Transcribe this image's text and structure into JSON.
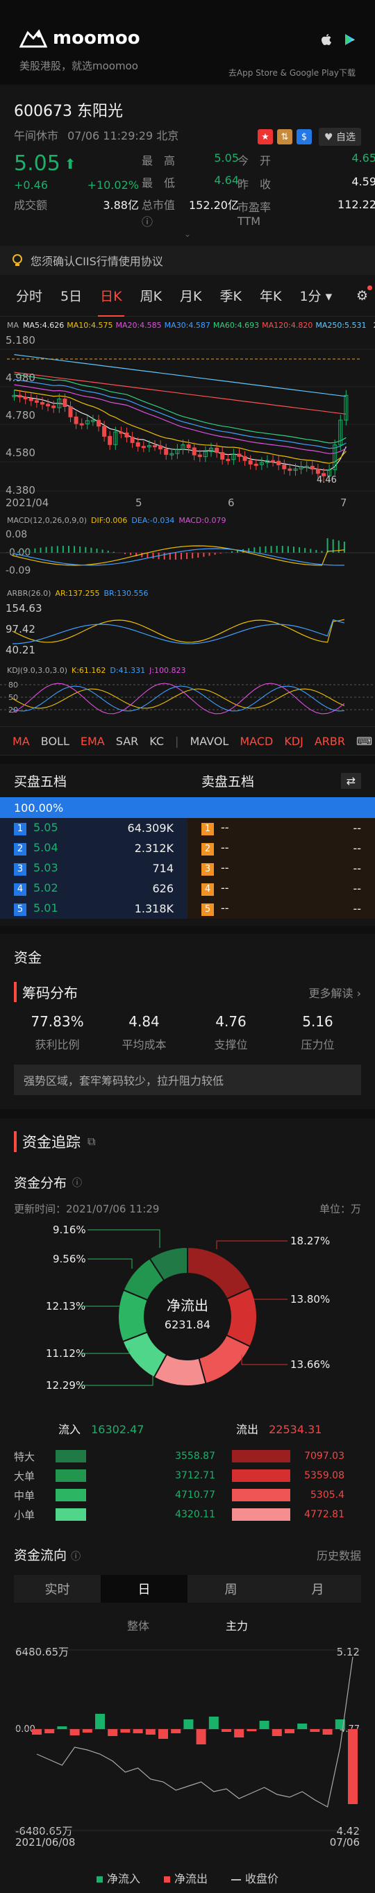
{
  "banner": {
    "brand": "moomoo",
    "tagline": "美股港股，就选moomoo",
    "store_text": "去App Store & Google Play下载"
  },
  "stock": {
    "code": "600673",
    "name": "东阳光",
    "status": "午间休市",
    "time": "07/06 11:29:29 北京",
    "watch_label": "自选",
    "price": "5.05",
    "change": "+0.46",
    "change_pct": "+10.02%",
    "volume_label": "成交额",
    "volume": "3.88亿",
    "high_label": "最　高",
    "high": "5.05",
    "low_label": "最　低",
    "low": "4.64",
    "cap_label": "总市值",
    "cap": "152.20亿",
    "open_label": "今　开",
    "open": "4.65",
    "prev_label": "昨　收",
    "prev": "4.59",
    "pe_label": "市盈率TTM",
    "pe": "112.22"
  },
  "notice": "您须确认CIIS行情使用协议",
  "tabs": [
    "分时",
    "5日",
    "日K",
    "周K",
    "月K",
    "季K",
    "年K",
    "1分"
  ],
  "active_tab": 2,
  "ma": {
    "title": "MA",
    "items": [
      {
        "label": "MA5:4.626",
        "color": "#e8e8e8"
      },
      {
        "label": "MA10:4.575",
        "color": "#f0c000"
      },
      {
        "label": "MA20:4.585",
        "color": "#e050e0"
      },
      {
        "label": "MA30:4.587",
        "color": "#40a0ff"
      },
      {
        "label": "MA60:4.693",
        "color": "#30d080"
      },
      {
        "label": "MA120:4.820",
        "color": "#ff5050"
      },
      {
        "label": "MA250:5.531",
        "color": "#60c8ff"
      }
    ],
    "right": "2"
  },
  "kline": {
    "y_top": "5.180",
    "y1": "4.980",
    "y2": "4.780",
    "y3": "4.580",
    "y_bottom": "4.380",
    "x_labels": [
      "2021/04",
      "5",
      "6",
      "7"
    ],
    "low_mark": "4.46"
  },
  "macd": {
    "label": "MACD(12,0,26,0,9,0)",
    "dif": "DIF:0.006",
    "dea": "DEA:-0.034",
    "macd": "MACD:0.079",
    "y": [
      "0.08",
      "-0.00",
      "-0.09"
    ]
  },
  "arbr": {
    "label": "ARBR(26.0)",
    "ar": "AR:137.255",
    "br": "BR:130.556",
    "y": [
      "154.63",
      "97.42",
      "40.21"
    ]
  },
  "kdj": {
    "label": "KDJ(9.0,3.0,3.0)",
    "k": "K:61.162",
    "d": "D:41.331",
    "j": "J:100.823",
    "y": [
      "80",
      "50",
      "20"
    ]
  },
  "indicator_tabs": [
    "MA",
    "BOLL",
    "EMA",
    "SAR",
    "KC",
    "MAVOL",
    "MACD",
    "KDJ",
    "ARBR"
  ],
  "orderbook": {
    "buy_title": "买盘五档",
    "sell_title": "卖盘五档",
    "buy_pct": "100.00%",
    "buys": [
      {
        "n": "1",
        "price": "5.05",
        "vol": "64.309K"
      },
      {
        "n": "2",
        "price": "5.04",
        "vol": "2.312K"
      },
      {
        "n": "3",
        "price": "5.03",
        "vol": "714"
      },
      {
        "n": "4",
        "price": "5.02",
        "vol": "626"
      },
      {
        "n": "5",
        "price": "5.01",
        "vol": "1.318K"
      }
    ],
    "sells": [
      {
        "n": "1",
        "price": "--",
        "vol": "--"
      },
      {
        "n": "2",
        "price": "--",
        "vol": "--"
      },
      {
        "n": "3",
        "price": "--",
        "vol": "--"
      },
      {
        "n": "4",
        "price": "--",
        "vol": "--"
      },
      {
        "n": "5",
        "price": "--",
        "vol": "--"
      }
    ]
  },
  "funds_title": "资金",
  "chips": {
    "title": "筹码分布",
    "more": "更多解读",
    "items": [
      {
        "v": "77.83%",
        "l": "获利比例"
      },
      {
        "v": "4.84",
        "l": "平均成本"
      },
      {
        "v": "4.76",
        "l": "支撑位"
      },
      {
        "v": "5.16",
        "l": "压力位"
      }
    ],
    "tip": "强势区域，套牢筹码较少，拉升阻力较低"
  },
  "tracking": {
    "title": "资金追踪",
    "dist_title": "资金分布",
    "update": "更新时间：2021/07/06 11:29",
    "unit": "单位：万",
    "center_label": "净流出",
    "center_value": "6231.84",
    "left_labels": [
      "9.16%",
      "9.56%",
      "12.13%",
      "11.12%",
      "12.29%"
    ],
    "right_labels": [
      "18.27%",
      "13.80%",
      "13.66%"
    ],
    "inflow_label": "流入",
    "inflow": "16302.47",
    "outflow_label": "流出",
    "outflow": "22534.31",
    "rows": [
      {
        "cat": "特大",
        "in": "3558.87",
        "out": "7097.03"
      },
      {
        "cat": "大单",
        "in": "3712.71",
        "out": "5359.08"
      },
      {
        "cat": "中单",
        "in": "4710.77",
        "out": "5305.4"
      },
      {
        "cat": "小单",
        "in": "4320.11",
        "out": "4772.81"
      }
    ]
  },
  "flow": {
    "title": "资金流向",
    "history": "历史数据",
    "periods": [
      "实时",
      "日",
      "周",
      "月"
    ],
    "active": 1,
    "sub_tabs": [
      "整体",
      "主力"
    ],
    "y_top": "6480.65万",
    "y_mid": "0.00",
    "y_bottom": "-6480.65万",
    "p_top": "5.12",
    "p_mid": "4.77",
    "p_bottom": "4.42",
    "x_start": "2021/06/08",
    "x_end": "07/06",
    "legend_in": "净流入",
    "legend_out": "净流出",
    "legend_price": "收盘价"
  },
  "colors": {
    "up": "#19b26b",
    "down": "#f04848",
    "accent": "#ff4a3d",
    "blue": "#2478e5"
  }
}
